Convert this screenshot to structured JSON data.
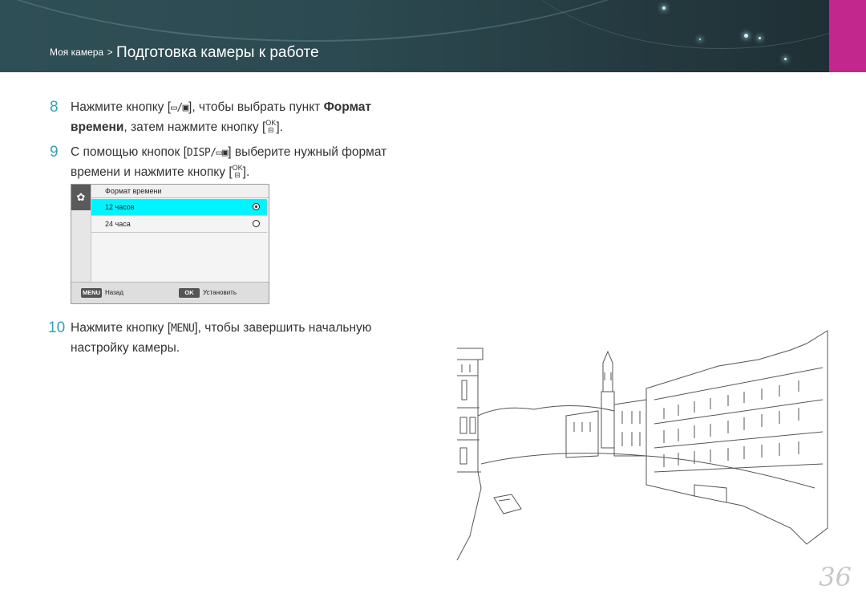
{
  "header": {
    "breadcrumb_parent": "Моя камера",
    "breadcrumb_separator": ">",
    "breadcrumb_current": "Подготовка камеры к работе",
    "accent_color": "#c2278e"
  },
  "steps": [
    {
      "number": "8",
      "t1": "Нажмите кнопку [",
      "key1": "▭/▣",
      "t2": "], чтобы выбрать пункт ",
      "bold1": "Формат времени",
      "t3": ", затем нажмите кнопку [",
      "ok_top": "OK",
      "ok_bottom": "⊟",
      "t4": "]."
    },
    {
      "number": "9",
      "t1": "С помощью кнопок [",
      "key1": "DISP/▭▣",
      "t2": "] выберите нужный формат времени и нажмите кнопку [",
      "ok_top": "OK",
      "ok_bottom": "⊟",
      "t3": "]."
    },
    {
      "number": "10",
      "t1": "Нажмите кнопку [",
      "key1": "MENU",
      "t2": "], чтобы завершить начальную настройку камеры."
    }
  ],
  "camera_screen": {
    "title": "Формат времени",
    "options": [
      {
        "label": "12 часов",
        "selected": true
      },
      {
        "label": "24 часа",
        "selected": false
      }
    ],
    "footer": {
      "back_key": "MENU",
      "back_label": "Назад",
      "ok_key": "OK",
      "ok_label": "Установить"
    },
    "highlight_color": "#00f4ff"
  },
  "page_number": "36",
  "step_number_color": "#2fa3b3"
}
